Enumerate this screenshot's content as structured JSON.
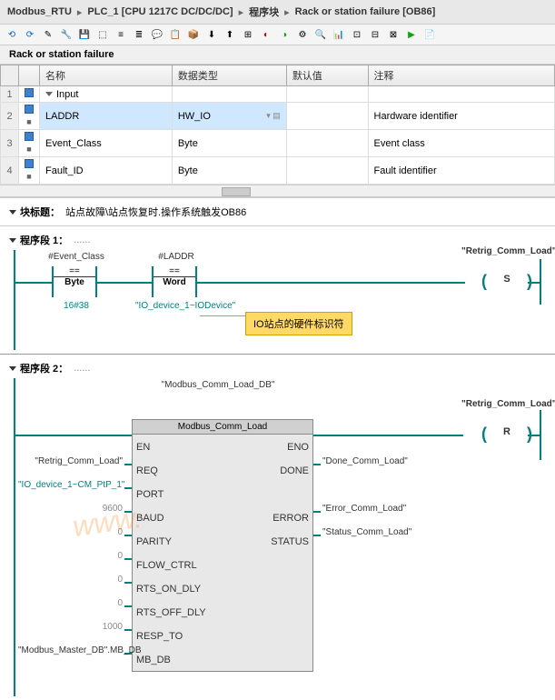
{
  "breadcrumb": {
    "seg1": "Modbus_RTU",
    "seg2": "PLC_1 [CPU 1217C DC/DC/DC]",
    "seg3": "程序块",
    "seg4": "Rack or station failure [OB86]"
  },
  "section_title": "Rack or station failure",
  "table": {
    "headers": {
      "name": "名称",
      "datatype": "数据类型",
      "default": "默认值",
      "comment": "注释"
    },
    "rows": [
      {
        "num": "1",
        "name": "Input",
        "indent": 1,
        "datatype": "",
        "default": "",
        "comment": "",
        "expand": true
      },
      {
        "num": "2",
        "name": "LADDR",
        "indent": 2,
        "datatype": "HW_IO",
        "default": "",
        "comment": "Hardware identifier",
        "dd": true,
        "hl": true
      },
      {
        "num": "3",
        "name": "Event_Class",
        "indent": 2,
        "datatype": "Byte",
        "default": "",
        "comment": "Event class"
      },
      {
        "num": "4",
        "name": "Fault_ID",
        "indent": 2,
        "datatype": "Byte",
        "default": "",
        "comment": "Fault identifier"
      }
    ]
  },
  "block_title": {
    "label": "块标题：",
    "text": "站点故障\\站点恢复时.操作系统触发OB86"
  },
  "segment1": {
    "title": "程序段 1：",
    "ellipsis": "......",
    "cmp1": {
      "tag": "#Event_Class",
      "op": "==",
      "type": "Byte",
      "val": "16#38"
    },
    "cmp2": {
      "tag": "#LADDR",
      "op": "==",
      "type": "Word",
      "val": "\"IO_device_1~IODevice\""
    },
    "coil": {
      "text": "\"Retrig_Comm_Load\"",
      "type": "S"
    },
    "callout": "IO站点的硬件标识符"
  },
  "segment2": {
    "title": "程序段 2：",
    "ellipsis": "......",
    "instance": "\"Modbus_Comm_Load_DB\"",
    "fb_name": "Modbus_Comm_Load",
    "pins_left": [
      {
        "label": "",
        "name": "EN"
      },
      {
        "label": "\"Retrig_Comm_Load\"",
        "name": "REQ"
      },
      {
        "label": "\"IO_device_1~CM_PtP_1\"",
        "name": "PORT",
        "color": "teal"
      },
      {
        "label": "9600",
        "name": "BAUD",
        "color": "gray"
      },
      {
        "label": "0",
        "name": "PARITY",
        "color": "gray"
      },
      {
        "label": "0",
        "name": "FLOW_CTRL",
        "color": "gray"
      },
      {
        "label": "0",
        "name": "RTS_ON_DLY",
        "color": "gray"
      },
      {
        "label": "0",
        "name": "RTS_OFF_DLY",
        "color": "gray"
      },
      {
        "label": "1000",
        "name": "RESP_TO",
        "color": "gray"
      },
      {
        "label": "\"Modbus_Master_DB\".MB_DB",
        "name": "MB_DB"
      }
    ],
    "pins_right": [
      {
        "name": "ENO",
        "label": ""
      },
      {
        "name": "DONE",
        "label": "\"Done_Comm_Load\""
      },
      {
        "name": "ERROR",
        "label": "\"Error_Comm_Load\""
      },
      {
        "name": "STATUS",
        "label": "\"Status_Comm_Load\""
      }
    ],
    "coil": {
      "text": "\"Retrig_Comm_Load\"",
      "type": "R"
    }
  }
}
